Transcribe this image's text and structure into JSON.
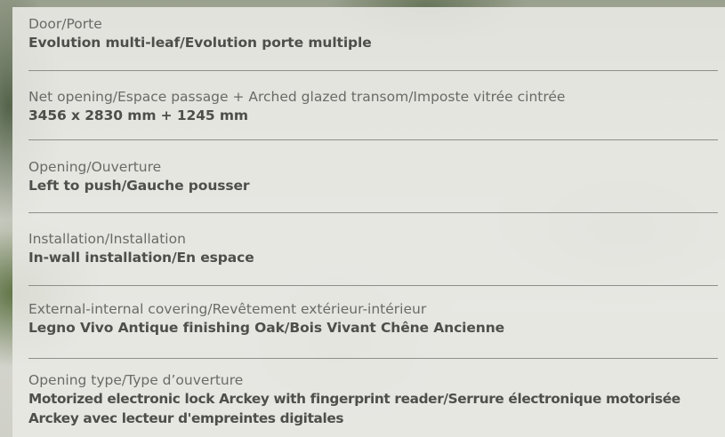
{
  "specs": [
    {
      "label": "Door/Porte",
      "value": "Evolution multi-leaf/Evolution porte multiple"
    },
    {
      "label": "Net opening/Espace passage + Arched glazed transom/Imposte vitrée cintrée",
      "value": "3456 x 2830 mm + 1245 mm"
    },
    {
      "label": "Opening/Ouverture",
      "value": "Left to push/Gauche pousser"
    },
    {
      "label": "Installation/Installation",
      "value": "In-wall installation/En espace"
    },
    {
      "label": "External-internal covering/Revêtement extérieur-intérieur",
      "value": "Legno Vivo Antique finishing Oak/Bois Vivant Chêne Ancienne"
    },
    {
      "label": "Opening type/Type d’ouverture",
      "value": "Motorized electronic lock Arckey with fingerprint reader/Serrure électronique motorisée Arckey avec lecteur d'empreintes digitales"
    }
  ]
}
